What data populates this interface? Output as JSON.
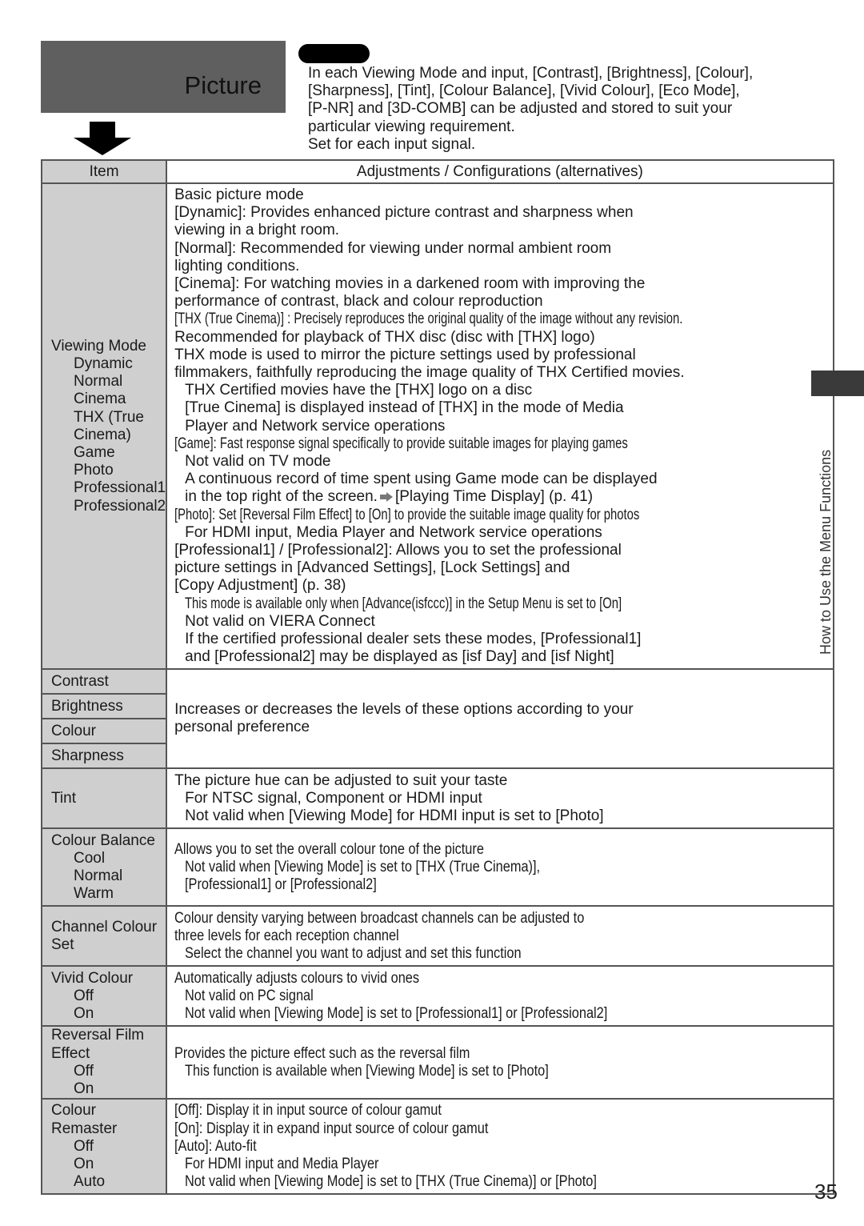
{
  "header": {
    "title": "Picture",
    "intro_lines": [
      "In each Viewing Mode and input, [Contrast], [Brightness], [Colour],",
      "[Sharpness], [Tint], [Colour Balance], [Vivid Colour], [Eco Mode],",
      "[P-NR] and [3D-COMB] can be adjusted and stored to suit your",
      "particular viewing requirement.",
      "Set for each input signal."
    ]
  },
  "table": {
    "headers": {
      "item": "Item",
      "adjustments": "Adjustments / Configurations (alternatives)"
    },
    "viewing_mode": {
      "label": "Viewing Mode",
      "options": [
        "Dynamic",
        "Normal",
        "Cinema",
        "THX (True Cinema)",
        "Game",
        "Photo",
        "Professional1",
        "Professional2"
      ],
      "lines": [
        {
          "text": "Basic picture mode",
          "indent": false,
          "condensed": false
        },
        {
          "text": "[Dynamic]:  Provides enhanced picture contrast and sharpness when",
          "indent": false,
          "condensed": false
        },
        {
          "text": "viewing in a bright room.",
          "indent": false,
          "condensed": false
        },
        {
          "text": "[Normal]:  Recommended for viewing under normal ambient room",
          "indent": false,
          "condensed": false
        },
        {
          "text": "lighting conditions.",
          "indent": false,
          "condensed": false
        },
        {
          "text": "[Cinema]:  For watching movies in a darkened room with improving the",
          "indent": false,
          "condensed": false
        },
        {
          "text": "performance of contrast, black and colour reproduction",
          "indent": false,
          "condensed": false
        },
        {
          "text": "[THX (True Cinema)] : Precisely reproduces the original quality of the image without any revision.",
          "indent": false,
          "condensed": true
        },
        {
          "text": "Recommended for playback of THX disc (disc with [THX] logo)",
          "indent": false,
          "condensed": false
        },
        {
          "text": "THX mode is used to mirror the picture settings used by professional",
          "indent": false,
          "condensed": false
        },
        {
          "text": "filmmakers, faithfully reproducing the image quality of THX Certified movies.",
          "indent": false,
          "condensed": false
        },
        {
          "text": "THX Certified movies have the [THX] logo on a disc",
          "indent": true,
          "condensed": false
        },
        {
          "text": "[True Cinema] is displayed instead of [THX] in the mode of Media",
          "indent": true,
          "condensed": false
        },
        {
          "text": "Player and Network service operations",
          "indent": true,
          "condensed": false
        },
        {
          "text": "[Game]:  Fast response signal specifically to provide suitable images for playing games",
          "indent": false,
          "condensed": true
        },
        {
          "text": "Not valid on TV mode",
          "indent": true,
          "condensed": false
        },
        {
          "text": "A continuous record of time spent using Game mode can be displayed",
          "indent": true,
          "condensed": false
        },
        {
          "text": "in the top right of the screen.",
          "indent": true,
          "condensed": false,
          "arrow": true,
          "after_arrow": "[Playing Time Display] (p. 41)"
        },
        {
          "text": "[Photo]:  Set [Reversal Film Effect] to [On] to provide the suitable image quality for photos",
          "indent": false,
          "condensed": true
        },
        {
          "text": "For HDMI input, Media Player and Network service operations",
          "indent": true,
          "condensed": false
        },
        {
          "text": "[Professional1] / [Professional2]:     Allows you to set the professional",
          "indent": false,
          "condensed": false
        },
        {
          "text": "picture settings in [Advanced Settings], [Lock Settings] and",
          "indent": false,
          "condensed": false
        },
        {
          "text": "[Copy Adjustment] (p. 38)",
          "indent": false,
          "condensed": false
        },
        {
          "text": "This mode is available only when [Advance(isfccc)] in the Setup Menu is set to [On]",
          "indent": true,
          "condensed": true
        },
        {
          "text": "Not valid on VIERA Connect",
          "indent": true,
          "condensed": false
        },
        {
          "text": "If the certified professional dealer sets these modes, [Professional1]",
          "indent": true,
          "condensed": false
        },
        {
          "text": "and [Professional2] may be displayed as [isf Day] and [isf Night]",
          "indent": true,
          "condensed": false
        }
      ]
    },
    "levels": {
      "items": [
        "Contrast",
        "Brightness",
        "Colour",
        "Sharpness"
      ],
      "lines": [
        "Increases or decreases the levels of these options according to your",
        "personal preference"
      ]
    },
    "rows": [
      {
        "label": "Tint",
        "options": [],
        "lines": [
          {
            "text": "The picture hue can be adjusted to suit your taste",
            "indent": false
          },
          {
            "text": "For NTSC signal, Component or HDMI input",
            "indent": true
          },
          {
            "text": "Not valid when [Viewing Mode] for HDMI input is set to [Photo]",
            "indent": true
          }
        ]
      },
      {
        "label": "Colour Balance",
        "options": [
          "Cool",
          "Normal",
          "Warm"
        ],
        "lines": [
          {
            "text": "Allows you to set the overall colour tone of the picture",
            "indent": false
          },
          {
            "text": "Not valid when [Viewing Mode] is set to [THX (True Cinema)],",
            "indent": true
          },
          {
            "text": "[Professional1] or [Professional2]",
            "indent": true
          }
        ]
      },
      {
        "label": "Channel Colour Set",
        "options": [],
        "lines": [
          {
            "text": "Colour density varying between broadcast channels can be adjusted to",
            "indent": false
          },
          {
            "text": "three levels for each reception channel",
            "indent": false
          },
          {
            "text": "Select the channel you want to adjust and set this function",
            "indent": true
          }
        ]
      },
      {
        "label": "Vivid Colour",
        "options": [
          "Off",
          "On"
        ],
        "lines": [
          {
            "text": "Automatically adjusts colours to vivid ones",
            "indent": false
          },
          {
            "text": "Not valid on PC signal",
            "indent": true
          },
          {
            "text": "Not valid when [Viewing Mode] is set to [Professional1] or [Professional2]",
            "indent": true
          }
        ]
      },
      {
        "label": "Reversal Film Effect",
        "options": [
          "Off",
          "On"
        ],
        "lines": [
          {
            "text": "Provides the picture effect such as the reversal film",
            "indent": false
          },
          {
            "text": "This function is available when [Viewing Mode] is set to [Photo]",
            "indent": true
          }
        ]
      },
      {
        "label": "Colour Remaster",
        "options": [
          "Off",
          "On",
          "Auto"
        ],
        "lines": [
          {
            "text": "[Off]:  Display it in input source of colour gamut",
            "indent": false
          },
          {
            "text": "[On]:  Display it in expand input source of colour gamut",
            "indent": false
          },
          {
            "text": "[Auto]:  Auto-fit",
            "indent": false
          },
          {
            "text": "For HDMI input and Media Player",
            "indent": true
          },
          {
            "text": "Not valid when [Viewing Mode] is set to [THX (True Cinema)] or [Photo]",
            "indent": true
          }
        ]
      }
    ]
  },
  "side": {
    "section_label": "How to Use the Menu Functions"
  },
  "footer": {
    "page_number": "35"
  }
}
